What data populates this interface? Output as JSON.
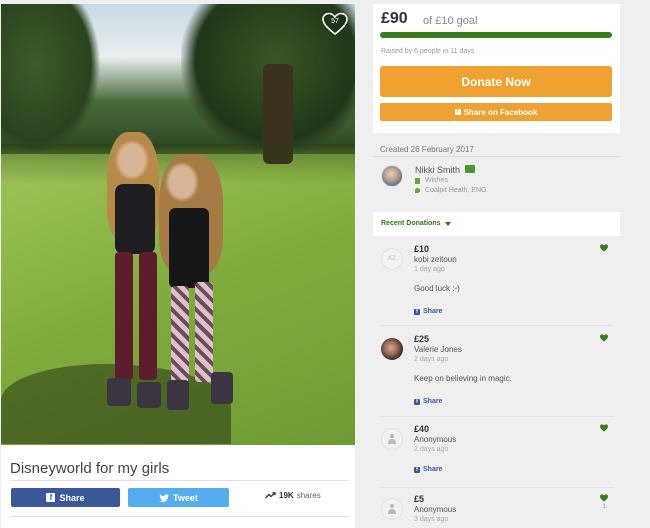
{
  "campaign": {
    "title": "Disneyworld for my girls",
    "heart_count": "57"
  },
  "share_bar": {
    "facebook_label": "Share",
    "twitter_label": "Tweet",
    "shares_count": "19K",
    "shares_label": "shares"
  },
  "goal": {
    "amount": "£90",
    "goal_text": "of £10 goal",
    "progress_fraction": 1.0,
    "raised_text": "Raised by 6 people in 11 days",
    "donate_label": "Donate Now",
    "facebook_label": "Share on Facebook"
  },
  "organizer": {
    "created": "Created 26 February 2017",
    "name": "Nikki Smith",
    "category": "Wishes",
    "location": "Coalpit Heath, ENG"
  },
  "recent": {
    "label": "Recent Donations"
  },
  "donations": [
    {
      "avatar_text": "KZ",
      "amount": "£10",
      "name": "kobi zeitoun",
      "time": "1 day ago",
      "message": "Good luck :-)",
      "share_label": "Share"
    },
    {
      "avatar_text": "",
      "amount": "£25",
      "name": "Valerie Jones",
      "time": "2 days ago",
      "message": "Keep on believing in magic.",
      "share_label": "Share"
    },
    {
      "avatar_text": "",
      "amount": "£40",
      "name": "Anonymous",
      "time": "2 days ago",
      "message": "",
      "share_label": "Share"
    },
    {
      "avatar_text": "",
      "amount": "£5",
      "name": "Anonymous",
      "time": "3 days ago",
      "message": "",
      "share_label": "",
      "heart_count": "1"
    }
  ],
  "colors": {
    "accent_orange": "#efa231",
    "progress_green": "#3c7a1c",
    "facebook_blue": "#3b5998",
    "twitter_blue": "#55acee"
  }
}
